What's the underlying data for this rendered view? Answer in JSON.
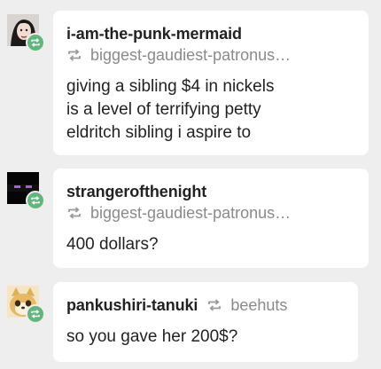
{
  "posts": [
    {
      "username": "i-am-the-punk-mermaid",
      "reblogged_from": "biggest-gaudiest-patronus…",
      "body": "giving a sibling $4 in nickels\nis a level of terrifying petty\neldritch sibling i aspire to"
    },
    {
      "username": "strangerofthenight",
      "reblogged_from": "biggest-gaudiest-patronus…",
      "body": "400 dollars?"
    },
    {
      "username": "pankushiri-tanuki",
      "reblogged_from": "beehuts",
      "body": "so you gave her 200$?"
    }
  ],
  "colors": {
    "background": "#eeeeee",
    "card": "#ffffff",
    "reblog_badge": "#5fb87a",
    "muted_text": "#8a8a8a"
  },
  "icons": [
    "reblog-icon"
  ]
}
